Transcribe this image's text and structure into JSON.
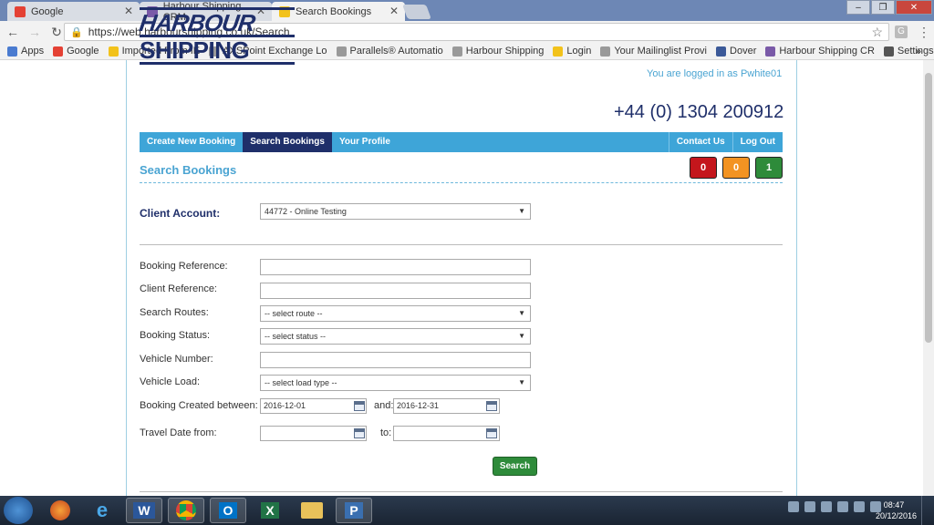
{
  "browser": {
    "tabs": [
      {
        "title": "Google",
        "color": "#e44134"
      },
      {
        "title": "Harbour Shipping CRM",
        "color": "#7a5aa8"
      },
      {
        "title": "Search Bookings",
        "color": "#f2c21b"
      }
    ],
    "url": "https://web.harbourshipping.co.uk/Search",
    "bookmarks": [
      {
        "label": "Apps",
        "color": "#4a7bd0"
      },
      {
        "label": "Google",
        "color": "#e44134"
      },
      {
        "label": "Imported From IE",
        "color": "#f2c21b"
      },
      {
        "label": "AXSPoint Exchange Lo",
        "color": "#999999"
      },
      {
        "label": "Parallels® Automatio",
        "color": "#999999"
      },
      {
        "label": "Harbour Shipping",
        "color": "#999999"
      },
      {
        "label": "Login",
        "color": "#f2c21b"
      },
      {
        "label": "Your Mailinglist Provi",
        "color": "#999999"
      },
      {
        "label": "Dover",
        "color": "#3b5998"
      },
      {
        "label": "Harbour Shipping CR",
        "color": "#7a5aa8"
      },
      {
        "label": "Settings",
        "color": "#555555"
      }
    ],
    "more": "»"
  },
  "header": {
    "logo_top": "HARBOUR",
    "logo_bottom": "SHIPPING",
    "logged_in": "You are logged in as Pwhite01",
    "phone": "+44 (0) 1304 200912"
  },
  "nav": {
    "left": [
      "Create New Booking",
      "Search Bookings",
      "Your Profile"
    ],
    "right": [
      "Contact Us",
      "Log Out"
    ]
  },
  "section": {
    "title": "Search Bookings",
    "badges": [
      {
        "value": "0",
        "color": "#c4161c"
      },
      {
        "value": "0",
        "color": "#f39322"
      },
      {
        "value": "1",
        "color": "#2e8b3a"
      }
    ]
  },
  "form": {
    "client_account_label": "Client Account:",
    "client_account_value": "44772 - Online Testing",
    "booking_reference_label": "Booking Reference:",
    "client_reference_label": "Client Reference:",
    "search_routes_label": "Search Routes:",
    "search_routes_value": "-- select route --",
    "booking_status_label": "Booking Status:",
    "booking_status_value": "-- select status --",
    "vehicle_number_label": "Vehicle Number:",
    "vehicle_load_label": "Vehicle Load:",
    "vehicle_load_value": "-- select load type --",
    "created_between_label": "Booking Created between:",
    "created_from": "2016-12-01",
    "and_label": "and:",
    "created_to": "2016-12-31",
    "travel_from_label": "Travel Date from:",
    "to_label": "to:",
    "search_button": "Search"
  },
  "taskbar": {
    "apps": [
      "e",
      "W",
      "O",
      "X",
      "P"
    ],
    "time": "08:47",
    "date": "20/12/2016"
  }
}
